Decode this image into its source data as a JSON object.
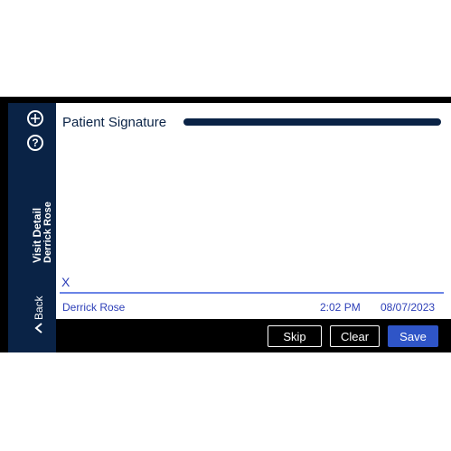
{
  "sidebar": {
    "add_icon": "plus-circle-icon",
    "help_icon": "question-circle-icon",
    "help_glyph": "?",
    "title": "Visit Detail",
    "patient": "Derrick Rose",
    "back_label": "Back",
    "back_icon": "chevron-left-icon"
  },
  "signature": {
    "title": "Patient Signature",
    "x_mark": "X",
    "signer": "Derrick Rose",
    "time": "2:02 PM",
    "date": "08/07/2023"
  },
  "actions": {
    "skip": "Skip",
    "clear": "Clear",
    "save": "Save"
  },
  "colors": {
    "navy": "#0a2346",
    "accent_blue": "#2f55c7",
    "text_blue": "#2d3fb8",
    "line_blue": "#6a84e6"
  }
}
